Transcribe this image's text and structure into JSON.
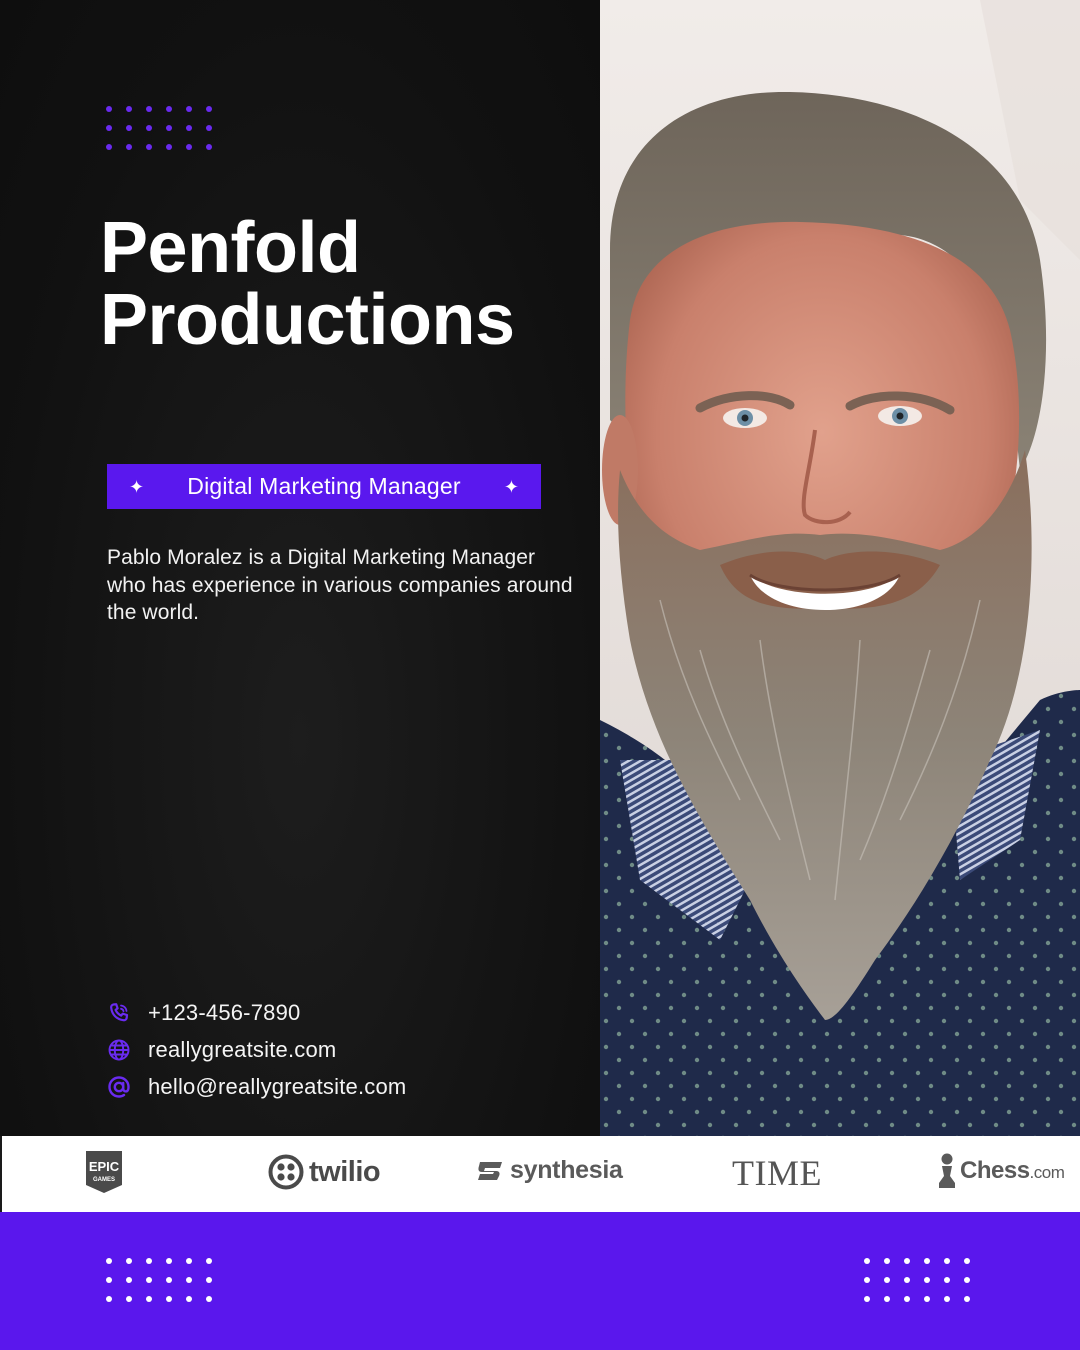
{
  "brand": {
    "title_line1": "Penfold",
    "title_line2": "Productions"
  },
  "role": {
    "label": "Digital Marketing Manager",
    "spark_glyph": "✦"
  },
  "bio": "Pablo Moralez is a Digital Marketing Manager who has experience in various companies around the world.",
  "contacts": [
    {
      "icon": "phone-icon",
      "text": "+123-456-7890"
    },
    {
      "icon": "globe-icon",
      "text": "reallygreatsite.com"
    },
    {
      "icon": "at-sign-icon",
      "text": "hello@reallygreatsite.com"
    }
  ],
  "logos": {
    "epic_line1": "EPIC",
    "epic_line2": "GAMES",
    "twilio": "twilio",
    "synthesia": "synthesia",
    "time": "TIME",
    "chess_main": "Chess",
    "chess_suffix": ".com"
  },
  "colors": {
    "accent_purple": "#5a18ee",
    "background_dark": "#121212",
    "text_light": "#ffffff",
    "logo_gray": "#4a4a4a"
  }
}
